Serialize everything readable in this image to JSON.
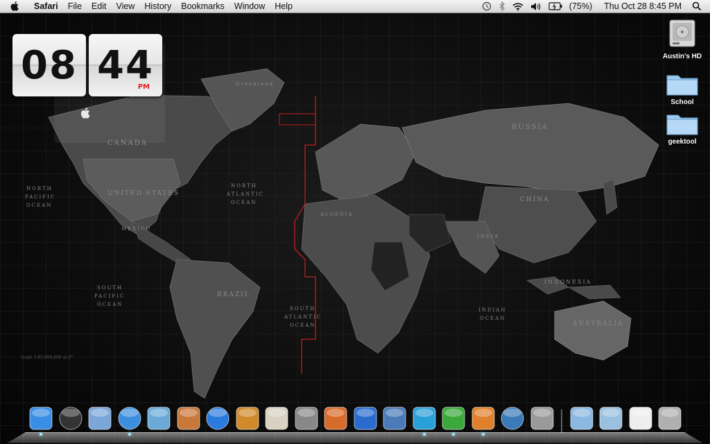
{
  "menubar": {
    "app_name": "Safari",
    "menus": [
      "File",
      "Edit",
      "View",
      "History",
      "Bookmarks",
      "Window",
      "Help"
    ],
    "battery": "(75%)",
    "datetime": "Thu Oct 28  8:45 PM",
    "status_icons": [
      "time-machine-icon",
      "bluetooth-icon",
      "wifi-icon",
      "volume-icon",
      "battery-icon",
      "spotlight-icon"
    ]
  },
  "clock_widget": {
    "hours": "08",
    "minutes": "44",
    "period": "PM"
  },
  "desktop_icons": [
    {
      "label": "Austin's HD",
      "type": "hard-drive"
    },
    {
      "label": "School",
      "type": "folder"
    },
    {
      "label": "geektool",
      "type": "folder"
    }
  ],
  "map": {
    "labels": {
      "canada": "CANADA",
      "united_states": "UNITED STATES",
      "mexico": "MEXICO",
      "brazil": "BRAZIL",
      "russia": "RUSSIA",
      "china": "CHINA",
      "india": "INDIA",
      "indonesia": "INDONESIA",
      "australia": "AUSTRALIA",
      "greenland": "Greenland",
      "algeria": "ALGERIA",
      "north_pacific": [
        "NORTH",
        "PACIFIC",
        "OCEAN"
      ],
      "north_atlantic": [
        "NORTH",
        "ATLANTIC",
        "OCEAN"
      ],
      "south_atlantic": [
        "SOUTH",
        "ATLANTIC",
        "OCEAN"
      ],
      "south_pacific": [
        "SOUTH",
        "PACIFIC",
        "OCEAN"
      ],
      "indian_ocean": [
        "INDIAN",
        "OCEAN"
      ],
      "scale": "Scale 1:85,000,000 at 0°"
    }
  },
  "dock": {
    "items": [
      {
        "name": "finder-icon",
        "color": "#3a8ee6"
      },
      {
        "name": "dashboard-icon",
        "color": "#333"
      },
      {
        "name": "mail-icon",
        "color": "#7aa6d8"
      },
      {
        "name": "safari-icon",
        "color": "#3b8fe0"
      },
      {
        "name": "iphoto-icon",
        "color": "#6aa9d8"
      },
      {
        "name": "photo-booth-icon",
        "color": "#c9783a"
      },
      {
        "name": "itunes-icon",
        "color": "#2a7be0"
      },
      {
        "name": "garageband-icon",
        "color": "#d08a2a"
      },
      {
        "name": "preview-icon",
        "color": "#d9d2c2"
      },
      {
        "name": "trash-app-icon",
        "color": "#888"
      },
      {
        "name": "keynote-icon",
        "color": "#d86a2a"
      },
      {
        "name": "numbers-icon",
        "color": "#2a6bd0"
      },
      {
        "name": "pages-icon",
        "color": "#4a7ab8"
      },
      {
        "name": "word-icon",
        "color": "#2aa0d8"
      },
      {
        "name": "excel-icon",
        "color": "#3aa83a"
      },
      {
        "name": "powerpoint-icon",
        "color": "#e0802a"
      },
      {
        "name": "time-machine-icon",
        "color": "#3a7ab8"
      },
      {
        "name": "system-preferences-icon",
        "color": "#9a9a9a"
      },
      {
        "name": "applications-folder-icon",
        "color": "#8ab8e0"
      },
      {
        "name": "documents-folder-icon",
        "color": "#9ac0e0"
      },
      {
        "name": "downloads-stack-icon",
        "color": "#eeeeee"
      },
      {
        "name": "trash-icon",
        "color": "#b0b0b0"
      }
    ]
  }
}
